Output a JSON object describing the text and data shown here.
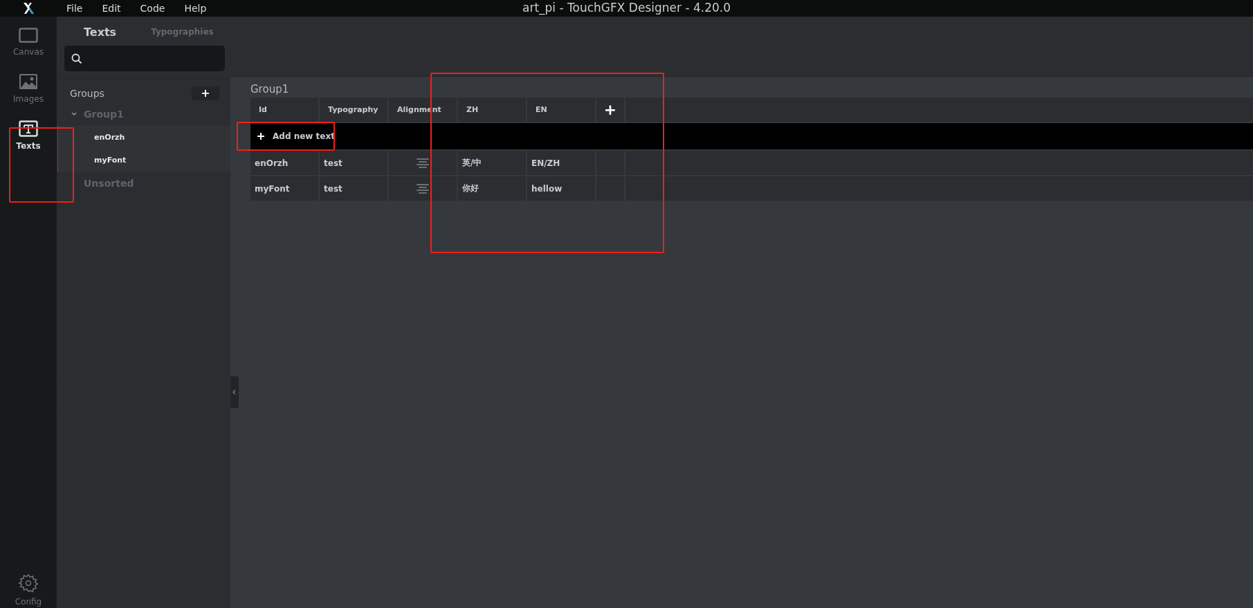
{
  "menu": [
    "File",
    "Edit",
    "Code",
    "Help"
  ],
  "window": {
    "title": "art_pi - TouchGFX Designer - 4.20.0"
  },
  "rail": [
    {
      "label": "Canvas",
      "kind": "canvas",
      "selected": false
    },
    {
      "label": "Images",
      "kind": "image",
      "selected": false
    },
    {
      "label": "Texts",
      "kind": "text",
      "selected": true
    }
  ],
  "rail_bottom": {
    "label": "Config"
  },
  "tabs": [
    {
      "label": "Texts",
      "selected": true
    },
    {
      "label": "Typographies",
      "selected": false
    }
  ],
  "groups": {
    "title": "Groups",
    "add": "+",
    "tree": [
      {
        "label": "Group1",
        "expanded": true,
        "children": [
          {
            "label": "enOrzh"
          },
          {
            "label": "myFont"
          }
        ]
      },
      {
        "label": "Unsorted",
        "expanded": false
      }
    ]
  },
  "table": {
    "title": "Group1",
    "columns": [
      "Id",
      "Typography",
      "Alignment",
      "ZH",
      "EN"
    ],
    "add_column": "+",
    "add_text": "Add new text",
    "rows": [
      [
        "enOrzh",
        "test",
        "",
        "英/中",
        "EN/ZH"
      ],
      [
        "myFont",
        "test",
        "",
        "你好",
        "hellow"
      ]
    ]
  }
}
